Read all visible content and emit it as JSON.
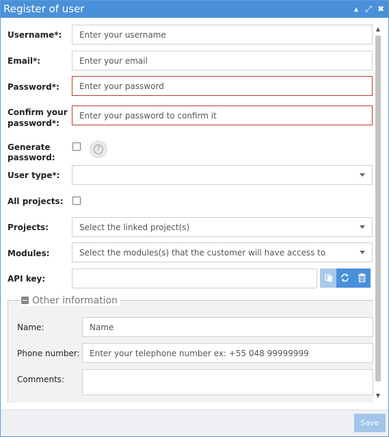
{
  "window": {
    "title": "Register of user",
    "controls": {
      "minimize": "▴",
      "maximize": "⤢",
      "close": "✖"
    }
  },
  "form": {
    "username": {
      "label": "Username*:",
      "placeholder": "Enter your username"
    },
    "email": {
      "label": "Email*:",
      "placeholder": "Enter your email"
    },
    "password": {
      "label": "Password*:",
      "placeholder": "Enter your password"
    },
    "confirm_password": {
      "label_line1": "Confirm your",
      "label_line2": "password*:",
      "placeholder": "Enter your password to confirm it"
    },
    "generate_password": {
      "label_line1": "Generate",
      "label_line2": "password:",
      "help_icon": "?"
    },
    "user_type": {
      "label": "User type*:",
      "value": ""
    },
    "all_projects": {
      "label": "All projects:"
    },
    "projects": {
      "label": "Projects:",
      "placeholder": "Select the linked project(s)"
    },
    "modules": {
      "label": "Modules:",
      "placeholder": "Select the modules(s) that the customer will have access to"
    },
    "api_key": {
      "label": "API key:",
      "value": ""
    }
  },
  "other_information": {
    "legend": "Other information",
    "name": {
      "label": "Name:",
      "placeholder": "Name"
    },
    "phone": {
      "label": "Phone number:",
      "placeholder": "Enter your telephone number ex: +55 048 99999999"
    },
    "comments": {
      "label": "Comments:",
      "value": ""
    }
  },
  "footer": {
    "save_label": "Save"
  },
  "colors": {
    "accent": "#4a90d9",
    "error_border": "#c0392b",
    "disabled_button": "#a3c5ea"
  },
  "icons": {
    "copy": "copy-icon",
    "refresh": "refresh-icon",
    "delete": "trash-icon",
    "help": "help-icon",
    "collapse": "minus-icon"
  }
}
